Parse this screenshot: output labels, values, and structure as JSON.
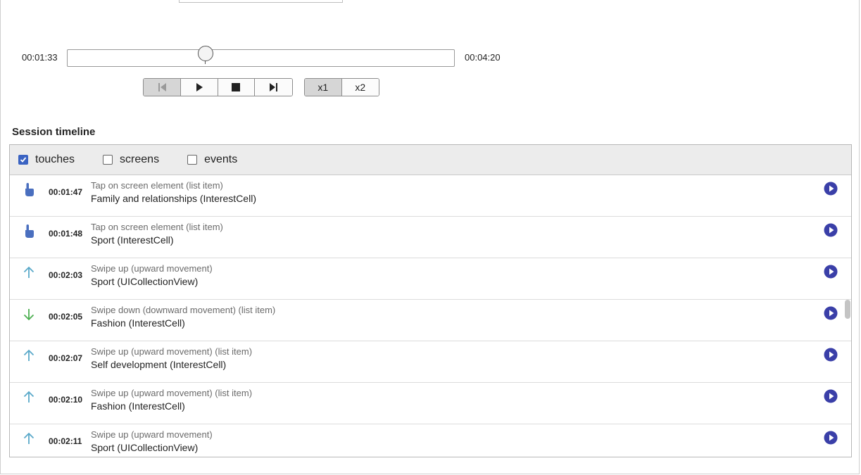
{
  "player": {
    "current_time": "00:01:33",
    "total_time": "00:04:20",
    "progress_fraction": 0.358,
    "transport_buttons": [
      {
        "name": "skip-back-icon"
      },
      {
        "name": "play-icon"
      },
      {
        "name": "stop-icon"
      },
      {
        "name": "skip-forward-icon"
      }
    ],
    "speed_options": [
      "x1",
      "x2"
    ],
    "selected_speed": "x1"
  },
  "timeline": {
    "title": "Session timeline",
    "filters": [
      {
        "label": "touches",
        "checked": true
      },
      {
        "label": "screens",
        "checked": false
      },
      {
        "label": "events",
        "checked": false
      }
    ],
    "rows": [
      {
        "icon": "tap-icon",
        "time": "00:01:47",
        "description": "Tap on screen element (list item)",
        "target": "Family and relationships (InterestCell)"
      },
      {
        "icon": "tap-icon",
        "time": "00:01:48",
        "description": "Tap on screen element (list item)",
        "target": "Sport (InterestCell)"
      },
      {
        "icon": "swipe-up-icon",
        "time": "00:02:03",
        "description": "Swipe up (upward movement)",
        "target": "Sport (UICollectionView)"
      },
      {
        "icon": "swipe-down-icon",
        "time": "00:02:05",
        "description": "Swipe down (downward movement) (list item)",
        "target": "Fashion (InterestCell)"
      },
      {
        "icon": "swipe-up-icon",
        "time": "00:02:07",
        "description": "Swipe up (upward movement) (list item)",
        "target": "Self development (InterestCell)"
      },
      {
        "icon": "swipe-up-icon",
        "time": "00:02:10",
        "description": "Swipe up (upward movement) (list item)",
        "target": "Fashion (InterestCell)"
      },
      {
        "icon": "swipe-up-icon",
        "time": "00:02:11",
        "description": "Swipe up (upward movement)",
        "target": "Sport (UICollectionView)"
      }
    ]
  },
  "colors": {
    "accent": "#3a3fa8",
    "tap_icon": "#4a6fbf",
    "swipe_up_icon": "#5aa9c9",
    "swipe_down_icon": "#4caf50",
    "checkbox": "#3a63c2"
  }
}
